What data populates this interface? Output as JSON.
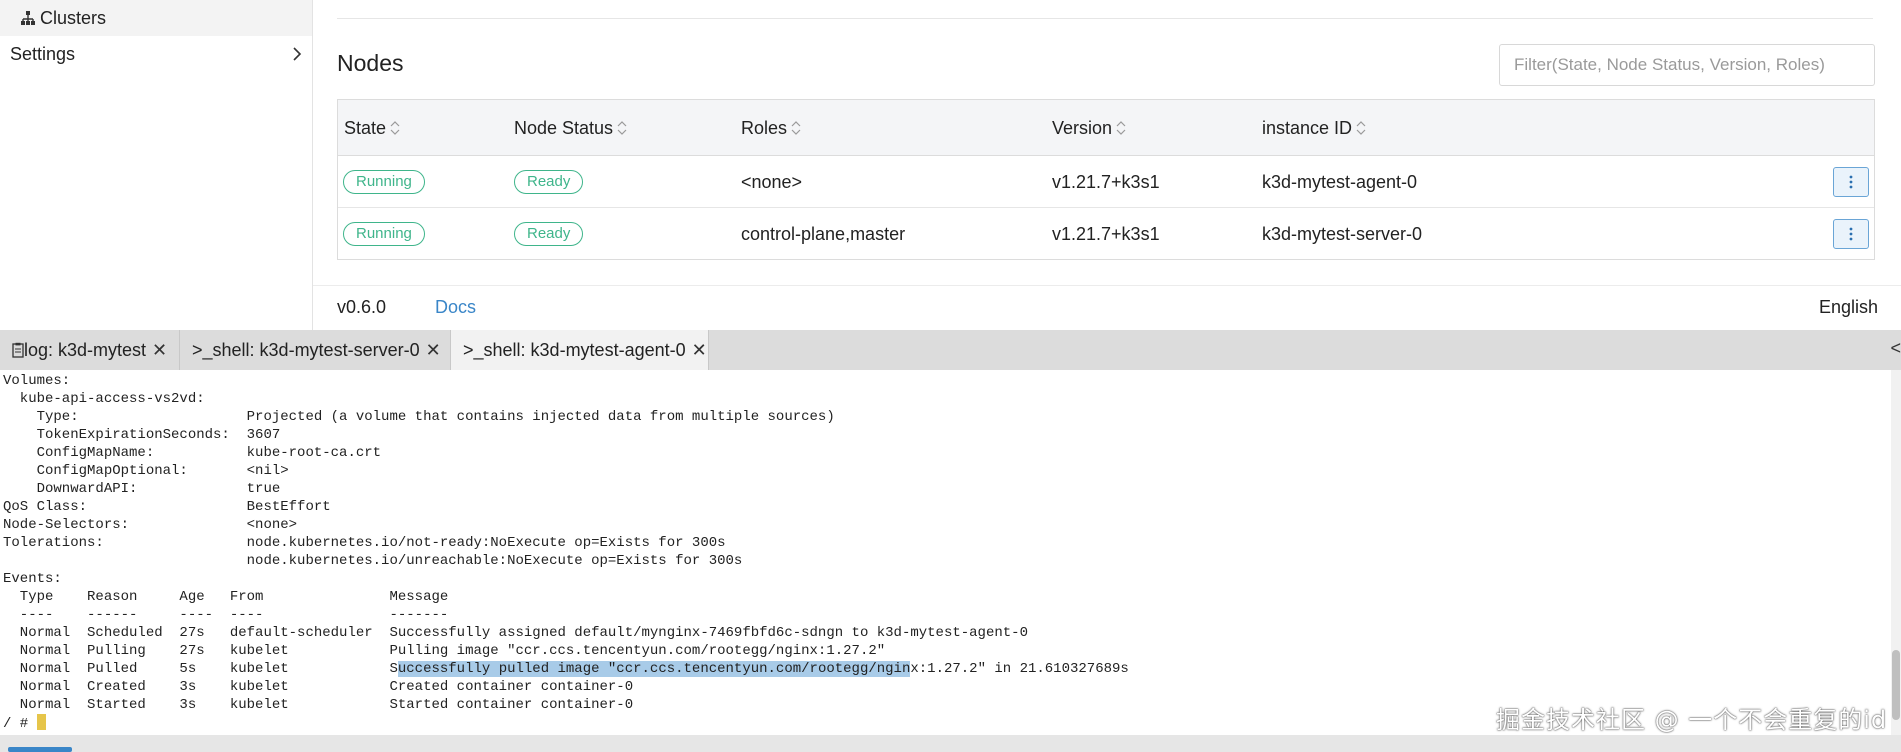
{
  "sidebar": {
    "clusters_label": "Clusters",
    "settings_label": "Settings"
  },
  "nodes": {
    "title": "Nodes",
    "filter_placeholder": "Filter(State, Node Status, Version, Roles)",
    "columns": [
      "State",
      "Node Status",
      "Roles",
      "Version",
      "instance ID"
    ],
    "rows": [
      {
        "state": "Running",
        "node_status": "Ready",
        "roles": "<none>",
        "version": "v1.21.7+k3s1",
        "instance_id": "k3d-mytest-agent-0"
      },
      {
        "state": "Running",
        "node_status": "Ready",
        "roles": "control-plane,master",
        "version": "v1.21.7+k3s1",
        "instance_id": "k3d-mytest-server-0"
      }
    ]
  },
  "footer": {
    "version": "v0.6.0",
    "docs_label": "Docs",
    "language": "English"
  },
  "tabs": [
    {
      "label": "log: k3d-mytest",
      "icon": "clipboard-icon"
    },
    {
      "label": "_shell: k3d-mytest-server-0",
      "icon": "terminal-icon"
    },
    {
      "label": "_shell: k3d-mytest-agent-0",
      "icon": "terminal-icon"
    }
  ],
  "tab_overflow": "<",
  "terminal": {
    "lines": [
      "Volumes:",
      "  kube-api-access-vs2vd:",
      "    Type:                    Projected (a volume that contains injected data from multiple sources)",
      "    TokenExpirationSeconds:  3607",
      "    ConfigMapName:           kube-root-ca.crt",
      "    ConfigMapOptional:       <nil>",
      "    DownwardAPI:             true",
      "QoS Class:                   BestEffort",
      "Node-Selectors:              <none>",
      "Tolerations:                 node.kubernetes.io/not-ready:NoExecute op=Exists for 300s",
      "                             node.kubernetes.io/unreachable:NoExecute op=Exists for 300s",
      "Events:",
      "  Type    Reason     Age   From               Message",
      "  ----    ------     ----  ----               -------",
      "  Normal  Scheduled  27s   default-scheduler  Successfully assigned default/mynginx-7469fbfd6c-sdngn to k3d-mytest-agent-0",
      "  Normal  Pulling    27s   kubelet            Pulling image \"ccr.ccs.tencentyun.com/rootegg/nginx:1.27.2\""
    ],
    "pulled_line": {
      "before": "  Normal  Pulled     5s    kubelet            S",
      "highlight": "uccessfully pulled image \"ccr.ccs.tencentyun.com/rootegg/ngin",
      "after": "x:1.27.2\" in 21.610327689s"
    },
    "lines_after": [
      "  Normal  Created    3s    kubelet            Created container container-0",
      "  Normal  Started    3s    kubelet            Started container container-0"
    ],
    "prompt": "/ # "
  },
  "watermark": "掘金技术社区 @ 一个不会重复的id",
  "colors": {
    "badge_green": "#3fb58b",
    "link_blue": "#3a86c8",
    "selection": "#a8cbe8",
    "cursor": "#e6c54a"
  }
}
